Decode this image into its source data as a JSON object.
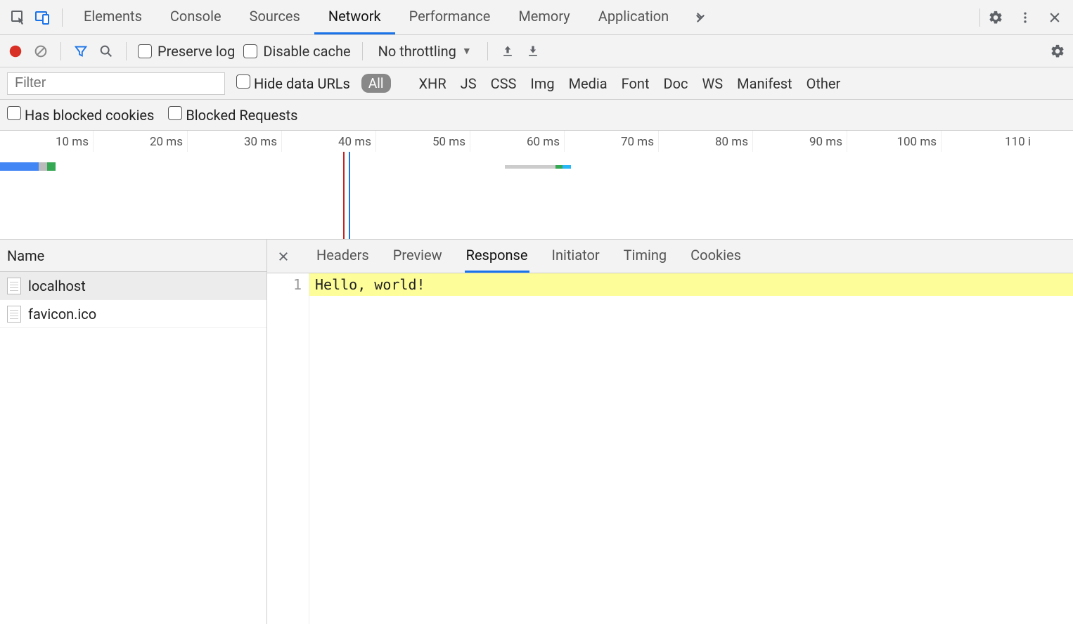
{
  "topTabs": {
    "items": [
      "Elements",
      "Console",
      "Sources",
      "Network",
      "Performance",
      "Memory",
      "Application"
    ],
    "activeIndex": 3
  },
  "toolbar": {
    "preserveLog": "Preserve log",
    "disableCache": "Disable cache",
    "throttling": "No throttling"
  },
  "filter": {
    "placeholder": "Filter",
    "hideDataUrls": "Hide data URLs",
    "types": {
      "all": "All",
      "xhr": "XHR",
      "js": "JS",
      "css": "CSS",
      "img": "Img",
      "media": "Media",
      "font": "Font",
      "doc": "Doc",
      "ws": "WS",
      "manifest": "Manifest",
      "other": "Other"
    },
    "hasBlockedCookies": "Has blocked cookies",
    "blockedRequests": "Blocked Requests"
  },
  "timeline": {
    "ticks": [
      "10 ms",
      "20 ms",
      "30 ms",
      "40 ms",
      "50 ms",
      "60 ms",
      "70 ms",
      "80 ms",
      "90 ms",
      "100 ms",
      "110 i"
    ]
  },
  "requests": {
    "header": "Name",
    "items": [
      {
        "name": "localhost"
      },
      {
        "name": "favicon.ico"
      }
    ],
    "selectedIndex": 0
  },
  "detailTabs": {
    "items": [
      "Headers",
      "Preview",
      "Response",
      "Initiator",
      "Timing",
      "Cookies"
    ],
    "activeIndex": 2
  },
  "response": {
    "lines": [
      {
        "num": "1",
        "text": "Hello, world!"
      }
    ]
  }
}
